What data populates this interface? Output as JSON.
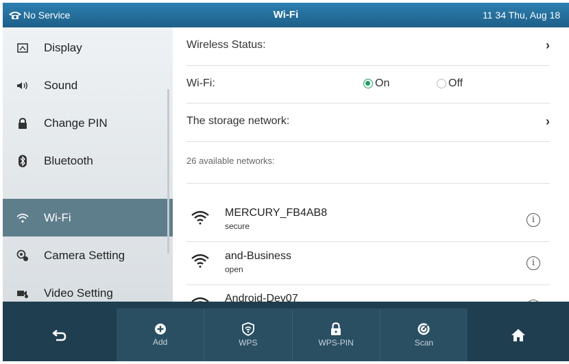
{
  "status_bar": {
    "service": "No Service",
    "title": "Wi-Fi",
    "datetime": "11 34 Thu, Aug 18"
  },
  "sidebar": {
    "items": [
      {
        "label": "Display",
        "icon": "display-icon"
      },
      {
        "label": "Sound",
        "icon": "speaker-icon"
      },
      {
        "label": "Change PIN",
        "icon": "lock-icon"
      },
      {
        "label": "Bluetooth",
        "icon": "bluetooth-icon"
      },
      {
        "label": "Wi-Fi",
        "icon": "wifi-icon",
        "active": true
      },
      {
        "label": "Camera Setting",
        "icon": "camera-icon"
      },
      {
        "label": "Video Setting",
        "icon": "video-icon"
      }
    ]
  },
  "content": {
    "wireless_status_label": "Wireless Status:",
    "wifi_label": "Wi-Fi:",
    "wifi_on_label": "On",
    "wifi_off_label": "Off",
    "wifi_selected": "On",
    "storage_network_label": "The storage network:",
    "available_networks_label": "26 available networks:",
    "networks": [
      {
        "name": "MERCURY_FB4AB8",
        "security": "secure"
      },
      {
        "name": "and-Business",
        "security": "open"
      },
      {
        "name": "Android-Dev07",
        "security": ""
      }
    ]
  },
  "softkeys": [
    {
      "label": "Add",
      "icon": "plus-icon"
    },
    {
      "label": "WPS",
      "icon": "wps-icon"
    },
    {
      "label": "WPS-PIN",
      "icon": "lock-icon"
    },
    {
      "label": "Scan",
      "icon": "scan-icon"
    }
  ],
  "colors": {
    "status_bar": "#2c7fb0",
    "sidebar_active": "#5f7e8c",
    "radio_on": "#1e9f61",
    "bottom_bar": "#1f3e4f"
  }
}
